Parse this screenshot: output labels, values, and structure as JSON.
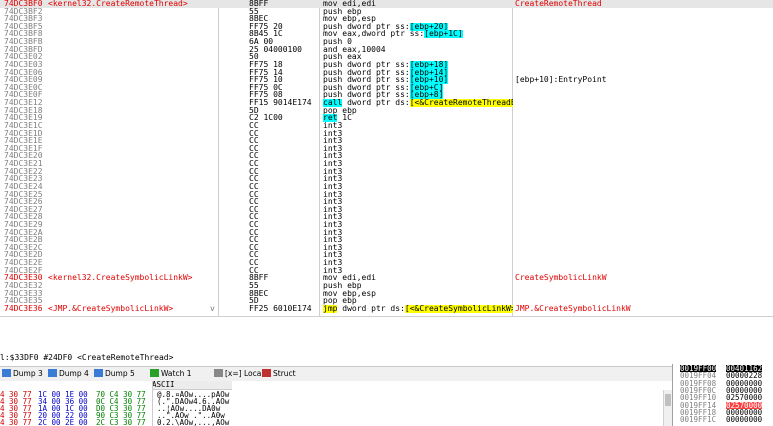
{
  "disasm": [
    {
      "addr": "74DC3BF0",
      "label": "<kernel32.CreateRemoteThread>",
      "bytes": "8BFF",
      "instr": "mov edi,edi",
      "comment": "CreateRemoteThread",
      "sel": true,
      "red": true
    },
    {
      "addr": "74DC3BF2",
      "label": "",
      "bytes": "55",
      "instr": "push ebp",
      "comment": ""
    },
    {
      "addr": "74DC3BF3",
      "label": "",
      "bytes": "8BEC",
      "instr": "mov ebp,esp",
      "comment": ""
    },
    {
      "addr": "74DC3BF5",
      "label": "",
      "bytes": "FF75 20",
      "instr": "push dword ptr ss:[ebp+20]",
      "comment": ""
    },
    {
      "addr": "74DC3BF8",
      "label": "",
      "bytes": "8B45 1C",
      "instr": "mov eax,dword ptr ss:[ebp+1C]",
      "comment": ""
    },
    {
      "addr": "74DC3BFB",
      "label": "",
      "bytes": "6A 00",
      "instr": "push 0",
      "comment": ""
    },
    {
      "addr": "74DC3BFD",
      "label": "",
      "bytes": "25 04000100",
      "instr": "and eax,10004",
      "comment": ""
    },
    {
      "addr": "74DC3E02",
      "label": "",
      "bytes": "50",
      "instr": "push eax",
      "comment": ""
    },
    {
      "addr": "74DC3E03",
      "label": "",
      "bytes": "FF75 18",
      "instr": "push dword ptr ss:[ebp+18]",
      "comment": ""
    },
    {
      "addr": "74DC3E06",
      "label": "",
      "bytes": "FF75 14",
      "instr": "push dword ptr ss:[ebp+14]",
      "comment": ""
    },
    {
      "addr": "74DC3E09",
      "label": "",
      "bytes": "FF75 10",
      "instr": "push dword ptr ss:[ebp+10]",
      "comment": "[ebp+10]:EntryPoint"
    },
    {
      "addr": "74DC3E0C",
      "label": "",
      "bytes": "FF75 0C",
      "instr": "push dword ptr ss:[ebp+C]",
      "comment": ""
    },
    {
      "addr": "74DC3E0F",
      "label": "",
      "bytes": "FF75 08",
      "instr": "push dword ptr ss:[ebp+8]",
      "comment": ""
    },
    {
      "addr": "74DC3E12",
      "label": "",
      "bytes": "FF15 9014E174",
      "instr": "call dword ptr ds:[<&CreateRemoteThreadEx>]",
      "comment": ""
    },
    {
      "addr": "74DC3E18",
      "label": "",
      "bytes": "5D",
      "instr": "pop ebp",
      "comment": ""
    },
    {
      "addr": "74DC3E19",
      "label": "",
      "bytes": "C2 1C00",
      "instr": "ret 1C",
      "comment": ""
    },
    {
      "addr": "74DC3E1C",
      "label": "",
      "bytes": "CC",
      "instr": "int3",
      "comment": ""
    },
    {
      "addr": "74DC3E1D",
      "label": "",
      "bytes": "CC",
      "instr": "int3",
      "comment": ""
    },
    {
      "addr": "74DC3E1E",
      "label": "",
      "bytes": "CC",
      "instr": "int3",
      "comment": ""
    },
    {
      "addr": "74DC3E1F",
      "label": "",
      "bytes": "CC",
      "instr": "int3",
      "comment": ""
    },
    {
      "addr": "74DC3E20",
      "label": "",
      "bytes": "CC",
      "instr": "int3",
      "comment": ""
    },
    {
      "addr": "74DC3E21",
      "label": "",
      "bytes": "CC",
      "instr": "int3",
      "comment": ""
    },
    {
      "addr": "74DC3E22",
      "label": "",
      "bytes": "CC",
      "instr": "int3",
      "comment": ""
    },
    {
      "addr": "74DC3E23",
      "label": "",
      "bytes": "CC",
      "instr": "int3",
      "comment": ""
    },
    {
      "addr": "74DC3E24",
      "label": "",
      "bytes": "CC",
      "instr": "int3",
      "comment": ""
    },
    {
      "addr": "74DC3E25",
      "label": "",
      "bytes": "CC",
      "instr": "int3",
      "comment": ""
    },
    {
      "addr": "74DC3E26",
      "label": "",
      "bytes": "CC",
      "instr": "int3",
      "comment": ""
    },
    {
      "addr": "74DC3E27",
      "label": "",
      "bytes": "CC",
      "instr": "int3",
      "comment": ""
    },
    {
      "addr": "74DC3E28",
      "label": "",
      "bytes": "CC",
      "instr": "int3",
      "comment": ""
    },
    {
      "addr": "74DC3E29",
      "label": "",
      "bytes": "CC",
      "instr": "int3",
      "comment": ""
    },
    {
      "addr": "74DC3E2A",
      "label": "",
      "bytes": "CC",
      "instr": "int3",
      "comment": ""
    },
    {
      "addr": "74DC3E2B",
      "label": "",
      "bytes": "CC",
      "instr": "int3",
      "comment": ""
    },
    {
      "addr": "74DC3E2C",
      "label": "",
      "bytes": "CC",
      "instr": "int3",
      "comment": ""
    },
    {
      "addr": "74DC3E2D",
      "label": "",
      "bytes": "CC",
      "instr": "int3",
      "comment": ""
    },
    {
      "addr": "74DC3E2E",
      "label": "",
      "bytes": "CC",
      "instr": "int3",
      "comment": ""
    },
    {
      "addr": "74DC3E2F",
      "label": "",
      "bytes": "CC",
      "instr": "int3",
      "comment": ""
    },
    {
      "addr": "74DC3E30",
      "label": "<kernel32.CreateSymbolicLinkW>",
      "bytes": "8BFF",
      "instr": "mov edi,edi",
      "comment": "CreateSymbolicLinkW",
      "red": true
    },
    {
      "addr": "74DC3E32",
      "label": "",
      "bytes": "55",
      "instr": "push ebp",
      "comment": ""
    },
    {
      "addr": "74DC3E33",
      "label": "",
      "bytes": "8BEC",
      "instr": "mov ebp,esp",
      "comment": ""
    },
    {
      "addr": "74DC3E35",
      "label": "",
      "bytes": "5D",
      "instr": "pop ebp",
      "comment": ""
    },
    {
      "addr": "74DC3E36",
      "label": "<JMP.&CreateSymbolicLinkW>",
      "bytes": "FF25 6010E174",
      "instr": "jmp dword ptr ds:[<&CreateSymbolicLinkW>]",
      "comment": "JMP.&CreateSymbolicLinkW",
      "red": true,
      "arrow": "v"
    }
  ],
  "info_line": "l:$33DF0 #24DF0 <CreateRemoteThread>",
  "tabs": [
    {
      "label": "Dump 3",
      "icon_color": "#3a7bd5"
    },
    {
      "label": "Dump 4",
      "icon_color": "#3a7bd5"
    },
    {
      "label": "Dump 5",
      "icon_color": "#3a7bd5"
    },
    {
      "label": "Watch 1",
      "icon_color": "#2aa02a"
    },
    {
      "label": "[x=] Locals",
      "icon_color": "#888888"
    },
    {
      "label": "Struct",
      "icon_color": "#c03030"
    }
  ],
  "dump_header": "ASCII",
  "dump_rows": [
    {
      "h1": "4 30 77",
      "h2": "1C 00 1E 00",
      "h3": "70 C4 30 77",
      "asc": "@.8.¤AOw....pAOw"
    },
    {
      "h1": "4 30 77",
      "h2": "34 00 36 00",
      "h3": "0C C4 30 77",
      "asc": "(.\".DAOw4.6..AOw"
    },
    {
      "h1": "4 30 77",
      "h2": "1A 00 1C 00",
      "h3": "D0 C3 30 77",
      "asc": "..¦AOw....DA0w"
    },
    {
      "h1": "4 30 77",
      "h2": "20 00 22 00",
      "h3": "90 C3 30 77",
      "asc": "..\".AOw .\"..A0w"
    },
    {
      "h1": "4 30 77",
      "h2": "2C 00 2E 00",
      "h3": "2C C3 30 77",
      "asc": "0.2.\\AOw,...,AOw"
    }
  ],
  "stack": [
    {
      "addr": "0019FF00",
      "val": "00401162",
      "top": true
    },
    {
      "addr": "0019FF04",
      "val": "00000228"
    },
    {
      "addr": "0019FF08",
      "val": "00000000"
    },
    {
      "addr": "0019FF0C",
      "val": "00000000"
    },
    {
      "addr": "0019FF10",
      "val": "02570000"
    },
    {
      "addr": "0019FF14",
      "val": "02570000",
      "red": true
    },
    {
      "addr": "0019FF18",
      "val": "00000000"
    },
    {
      "addr": "0019FF1C",
      "val": "00000000"
    }
  ]
}
